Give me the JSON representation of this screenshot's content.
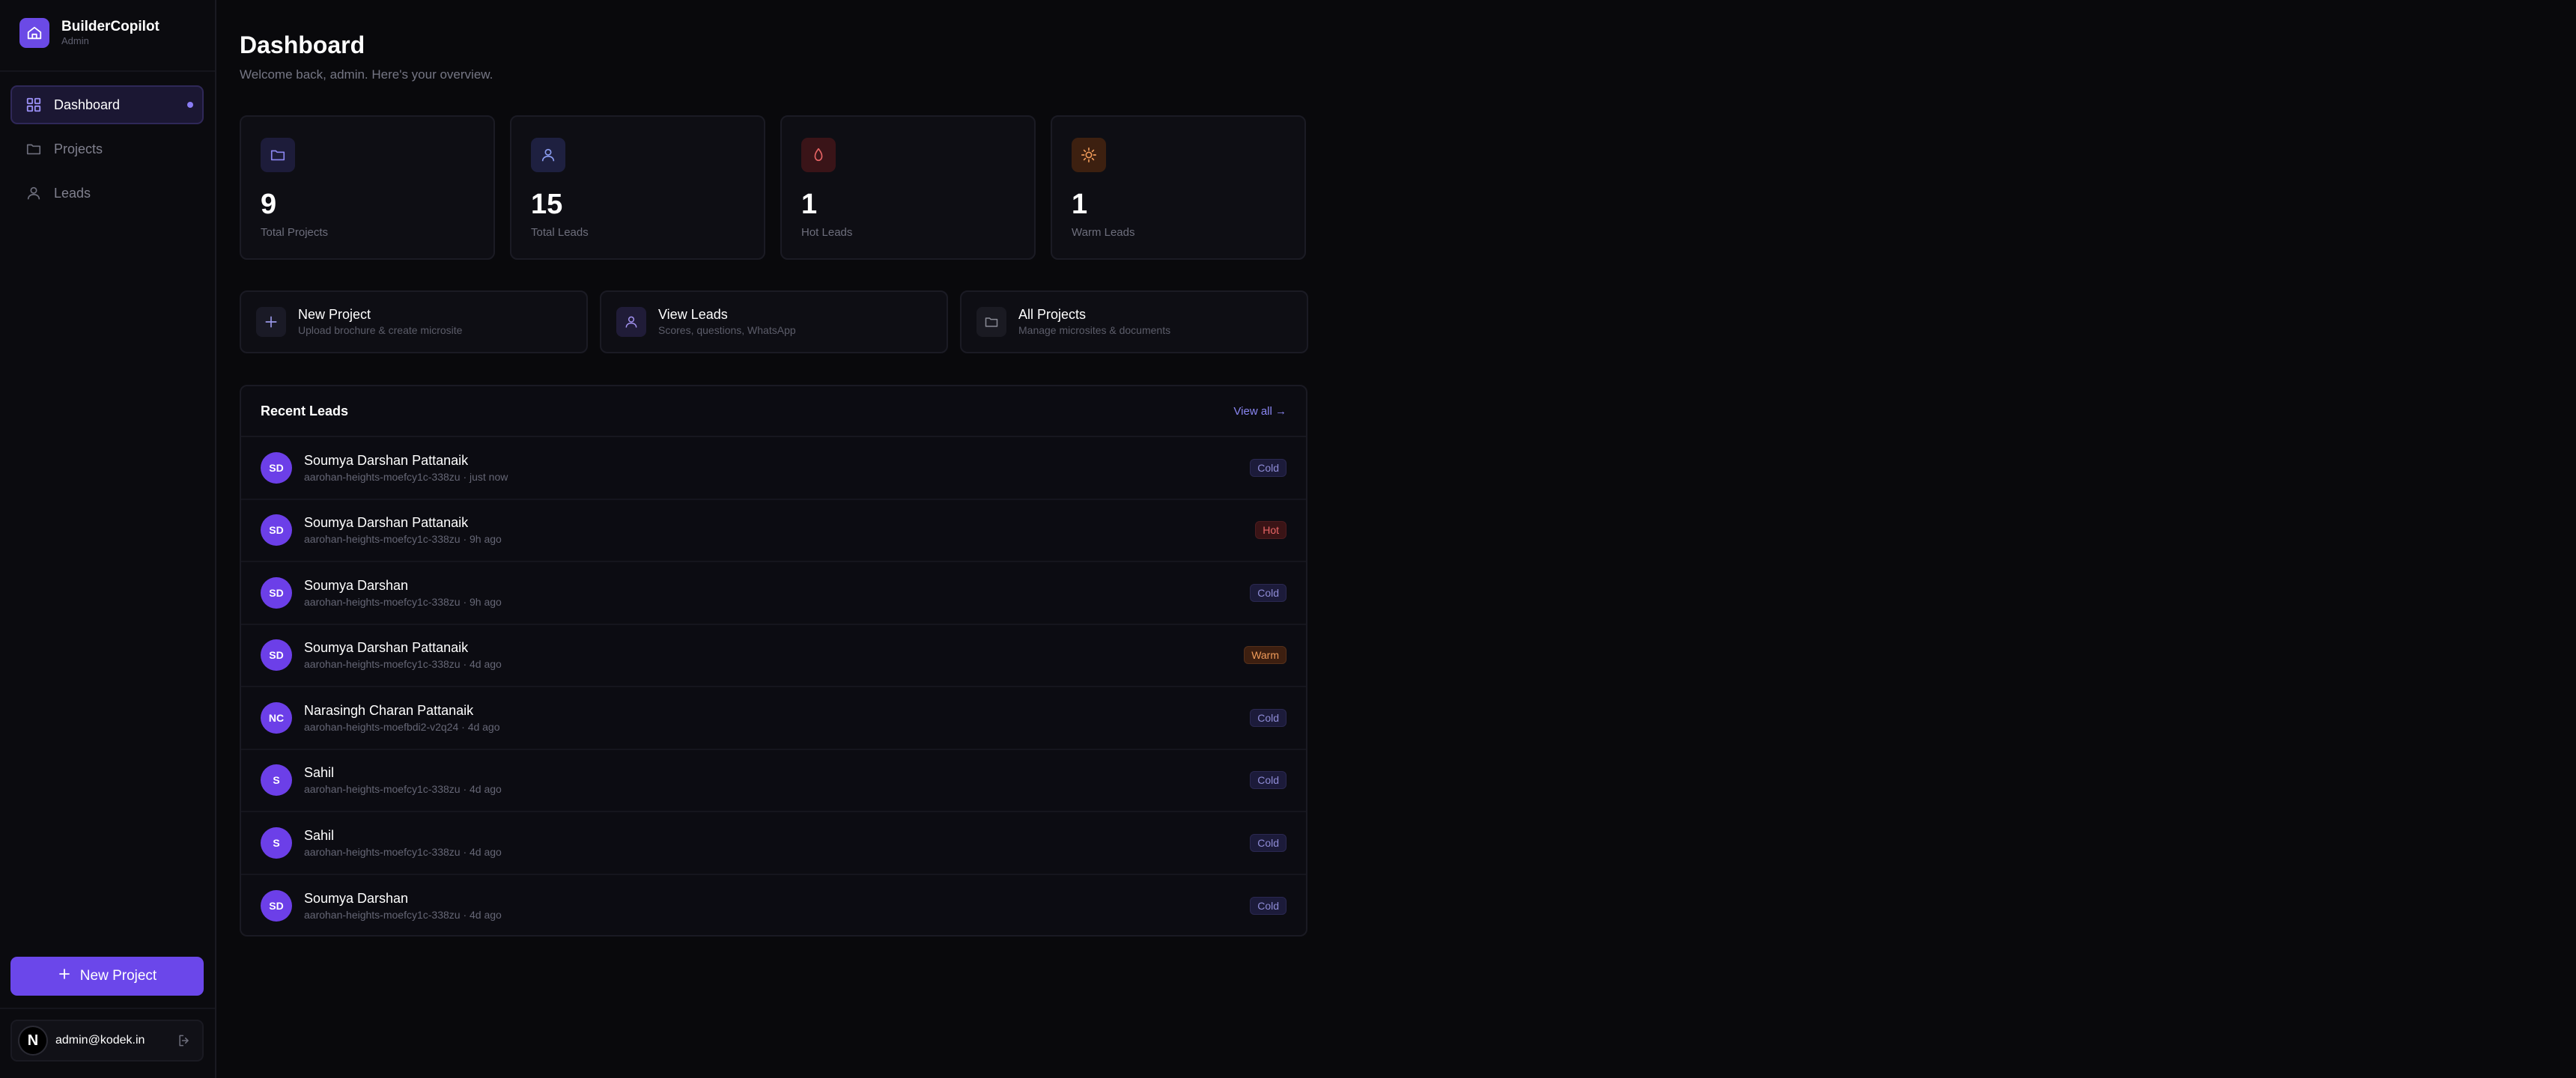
{
  "app": {
    "name": "BuilderCopilot",
    "role": "Admin"
  },
  "colors": {
    "accent": "#6b47ea",
    "hot": "#e86565",
    "warm": "#f09b5a",
    "cold": "#8f8cd6"
  },
  "sidebar": {
    "items": [
      {
        "label": "Dashboard",
        "icon": "grid-icon",
        "active": true
      },
      {
        "label": "Projects",
        "icon": "folder-icon",
        "active": false
      },
      {
        "label": "Leads",
        "icon": "user-icon",
        "active": false
      }
    ],
    "new_project_label": "New Project",
    "user_initial": "N",
    "user_email": "admin@kodek.in"
  },
  "header": {
    "title": "Dashboard",
    "subtitle": "Welcome back, admin. Here's your overview."
  },
  "stats": [
    {
      "value": "9",
      "label": "Total Projects",
      "icon": "folder-icon"
    },
    {
      "value": "15",
      "label": "Total Leads",
      "icon": "user-icon"
    },
    {
      "value": "1",
      "label": "Hot Leads",
      "icon": "flame-icon"
    },
    {
      "value": "1",
      "label": "Warm Leads",
      "icon": "sun-icon"
    }
  ],
  "actions": [
    {
      "title": "New Project",
      "desc": "Upload brochure & create microsite",
      "icon": "plus-icon"
    },
    {
      "title": "View Leads",
      "desc": "Scores, questions, WhatsApp",
      "icon": "user-icon"
    },
    {
      "title": "All Projects",
      "desc": "Manage microsites & documents",
      "icon": "folder-icon"
    }
  ],
  "recent_leads": {
    "title": "Recent Leads",
    "view_all": "View all →",
    "rows": [
      {
        "initials": "SD",
        "name": "Soumya Darshan Pattanaik",
        "meta": "aarohan-heights-moefcy1c-338zu · just now",
        "status": "Cold"
      },
      {
        "initials": "SD",
        "name": "Soumya Darshan Pattanaik",
        "meta": "aarohan-heights-moefcy1c-338zu · 9h ago",
        "status": "Hot"
      },
      {
        "initials": "SD",
        "name": "Soumya Darshan",
        "meta": "aarohan-heights-moefcy1c-338zu · 9h ago",
        "status": "Cold"
      },
      {
        "initials": "SD",
        "name": "Soumya Darshan Pattanaik",
        "meta": "aarohan-heights-moefcy1c-338zu · 4d ago",
        "status": "Warm"
      },
      {
        "initials": "NC",
        "name": "Narasingh Charan Pattanaik",
        "meta": "aarohan-heights-moefbdi2-v2q24 · 4d ago",
        "status": "Cold"
      },
      {
        "initials": "S",
        "name": "Sahil",
        "meta": "aarohan-heights-moefcy1c-338zu · 4d ago",
        "status": "Cold"
      },
      {
        "initials": "S",
        "name": "Sahil",
        "meta": "aarohan-heights-moefcy1c-338zu · 4d ago",
        "status": "Cold"
      },
      {
        "initials": "SD",
        "name": "Soumya Darshan",
        "meta": "aarohan-heights-moefcy1c-338zu · 4d ago",
        "status": "Cold"
      }
    ]
  }
}
